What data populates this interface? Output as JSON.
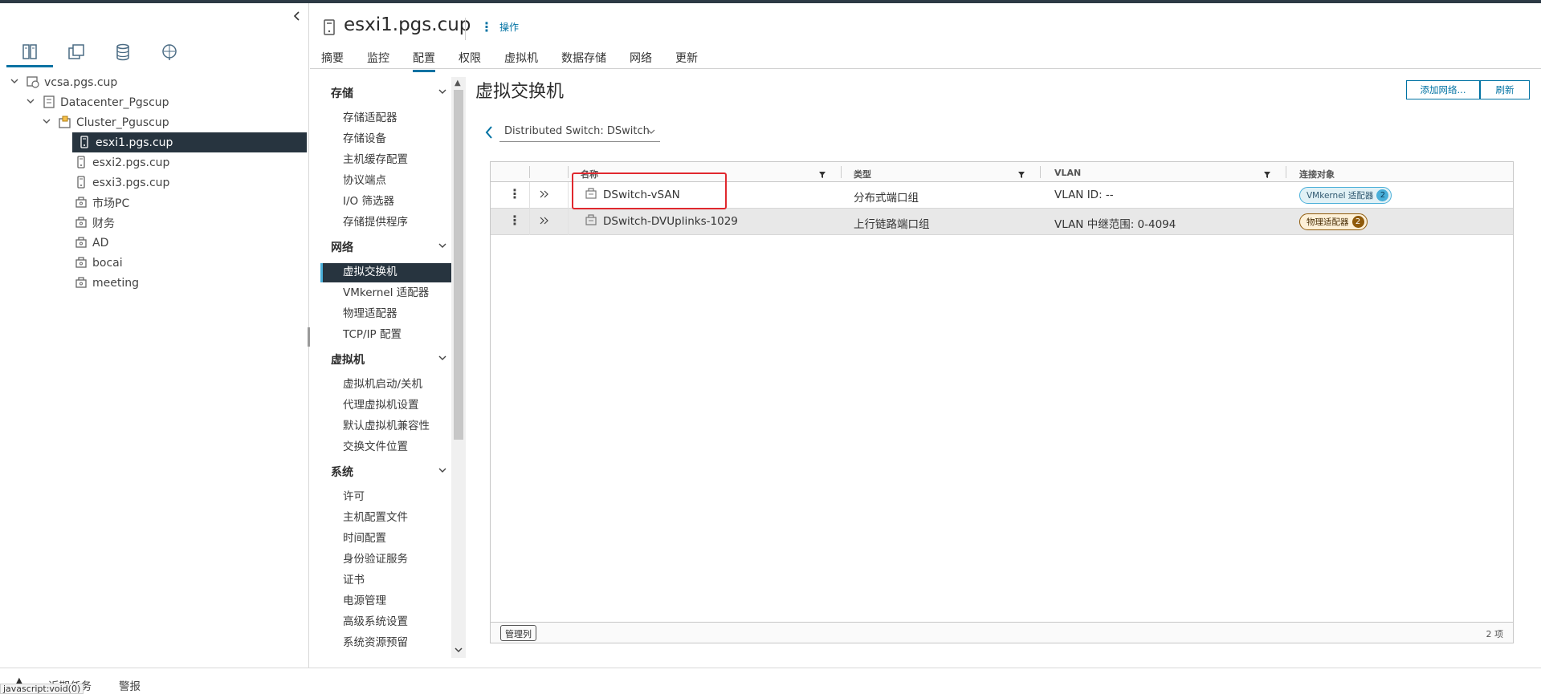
{
  "navigator": {
    "tabs": [
      "hosts-clusters-icon",
      "vms-templates-icon",
      "storage-icon",
      "networking-icon"
    ],
    "tree": [
      {
        "label": "vcsa.pgs.cup",
        "level": 0,
        "icon": "vcenter-icon",
        "expanded": true
      },
      {
        "label": "Datacenter_Pgscup",
        "level": 1,
        "icon": "datacenter-icon",
        "expanded": true
      },
      {
        "label": "Cluster_Pguscup",
        "level": 2,
        "icon": "cluster-icon",
        "expanded": true
      },
      {
        "label": "esxi1.pgs.cup",
        "level": 3,
        "icon": "host-icon",
        "selected": true
      },
      {
        "label": "esxi2.pgs.cup",
        "level": 3,
        "icon": "host-icon"
      },
      {
        "label": "esxi3.pgs.cup",
        "level": 3,
        "icon": "host-icon"
      },
      {
        "label": "市场PC",
        "level": 3,
        "icon": "resource-pool-icon"
      },
      {
        "label": "财务",
        "level": 3,
        "icon": "resource-pool-icon"
      },
      {
        "label": "AD",
        "level": 3,
        "icon": "resource-pool-icon"
      },
      {
        "label": "bocai",
        "level": 3,
        "icon": "resource-pool-icon"
      },
      {
        "label": "meeting",
        "level": 3,
        "icon": "resource-pool-icon"
      }
    ]
  },
  "header": {
    "title": "esxi1.pgs.cup",
    "actions_label": "操作",
    "tabs": [
      "摘要",
      "监控",
      "配置",
      "权限",
      "虚拟机",
      "数据存储",
      "网络",
      "更新"
    ],
    "active_tab": "配置"
  },
  "config_menu": {
    "sections": [
      {
        "title": "存储",
        "items": [
          "存储适配器",
          "存储设备",
          "主机缓存配置",
          "协议端点",
          "I/O 筛选器",
          "存储提供程序"
        ]
      },
      {
        "title": "网络",
        "items": [
          "虚拟交换机",
          "VMkernel 适配器",
          "物理适配器",
          "TCP/IP 配置"
        ]
      },
      {
        "title": "虚拟机",
        "items": [
          "虚拟机启动/关机",
          "代理虚拟机设置",
          "默认虚拟机兼容性",
          "交换文件位置"
        ]
      },
      {
        "title": "系统",
        "items": [
          "许可",
          "主机配置文件",
          "时间配置",
          "身份验证服务",
          "证书",
          "电源管理",
          "高级系统设置",
          "系统资源预留"
        ]
      }
    ],
    "active_item": "虚拟交换机"
  },
  "main": {
    "title": "虚拟交换机",
    "add_network_label": "添加网络...",
    "refresh_label": "刷新",
    "switch_select": "Distributed Switch: DSwitch",
    "grid": {
      "columns": [
        "名称",
        "类型",
        "VLAN",
        "连接对象"
      ],
      "rows": [
        {
          "name": "DSwitch-vSAN",
          "type": "分布式端口组",
          "vlan": "VLAN ID: --",
          "connected": "VMkernel 适配器",
          "count": "2",
          "badge_color": "#49afd9"
        },
        {
          "name": "DSwitch-DVUplinks-1029",
          "type": "上行链路端口组",
          "vlan": "VLAN 中继范围: 0-4094",
          "connected": "物理适配器",
          "count": "2",
          "badge_color": "#8f5a0a"
        }
      ],
      "manage_columns_label": "管理列",
      "item_count": "2 项"
    }
  },
  "bottom": {
    "tabs": [
      "近期任务",
      "警报"
    ],
    "status_text": "javascript:void(0)"
  },
  "colors": {
    "accent": "#0072a3",
    "selected_bg": "#27343f",
    "highlight": "#e0282e"
  }
}
